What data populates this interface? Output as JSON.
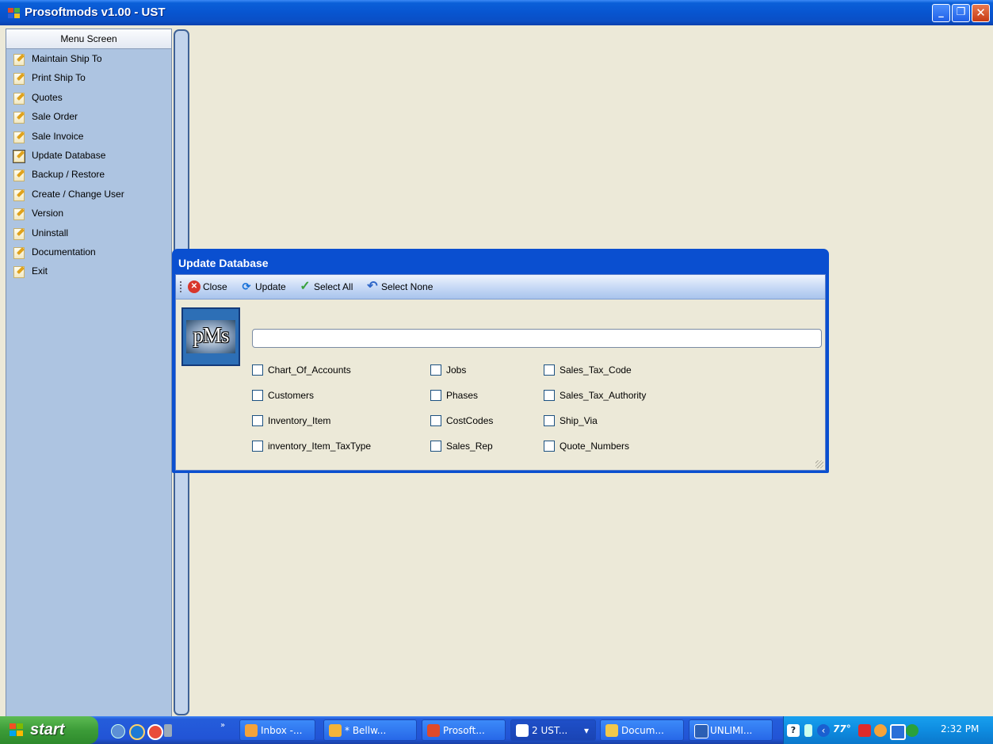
{
  "window": {
    "title": "Prosoftmods v1.00 - UST",
    "minimize_icon": "minimize-icon",
    "restore_icon": "restore-icon",
    "close_icon": "close-icon"
  },
  "menu": {
    "header": "Menu Screen",
    "items": [
      {
        "label": "Maintain Ship To"
      },
      {
        "label": "Print Ship To"
      },
      {
        "label": "Quotes"
      },
      {
        "label": "Sale Order"
      },
      {
        "label": "Sale Invoice"
      },
      {
        "label": "Update Database",
        "selected": true
      },
      {
        "label": "Backup / Restore"
      },
      {
        "label": "Create / Change User"
      },
      {
        "label": "Version"
      },
      {
        "label": "Uninstall"
      },
      {
        "label": "Documentation"
      },
      {
        "label": "Exit"
      }
    ]
  },
  "dialog": {
    "title": "Update Database",
    "toolbar": {
      "close": "Close",
      "update": "Update",
      "select_all": "Select All",
      "select_none": "Select None"
    },
    "logo_text": "pMs",
    "progress": 0,
    "checkboxes": {
      "col1": [
        "Chart_Of_Accounts",
        "Customers",
        "Inventory_Item",
        "inventory_Item_TaxType"
      ],
      "col2": [
        "Jobs",
        "Phases",
        "CostCodes",
        "Sales_Rep"
      ],
      "col3": [
        "Sales_Tax_Code",
        "Sales_Tax_Authority",
        "Ship_Via",
        "Quote_Numbers"
      ]
    }
  },
  "taskbar": {
    "start": "start",
    "overflow": "»",
    "tasks": [
      {
        "label": "Inbox -..."
      },
      {
        "label": "* Bellw..."
      },
      {
        "label": "Prosoft..."
      },
      {
        "label": "2 UST...",
        "active": true
      },
      {
        "label": "Docum..."
      },
      {
        "label": "UNLIMI..."
      }
    ],
    "tray": {
      "temperature": "77°",
      "clock": "2:32 PM"
    }
  },
  "colors": {
    "titlebar": "#0855d0",
    "menu_panel": "#adc4e1",
    "dialog_frame": "#0a4fd0",
    "desktop": "#ece9d8",
    "start_button": "#3c9c38",
    "taskbar": "#2254d6"
  }
}
